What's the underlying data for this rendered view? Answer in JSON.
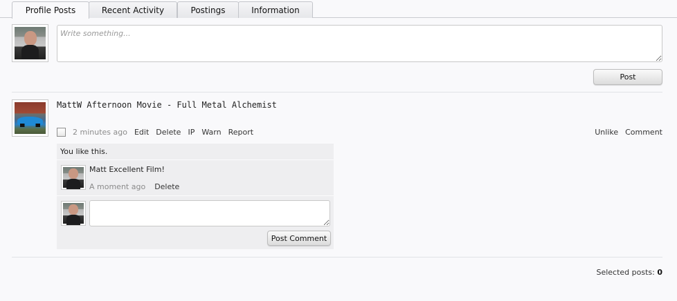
{
  "tabs": [
    {
      "label": "Profile Posts",
      "active": true
    },
    {
      "label": "Recent Activity"
    },
    {
      "label": "Postings"
    },
    {
      "label": "Information"
    }
  ],
  "composer": {
    "placeholder": "Write something...",
    "value": "",
    "post_label": "Post"
  },
  "message": {
    "username": "MattW",
    "text": "Afternoon Movie - Full Metal Alchemist",
    "time": "2 minutes ago",
    "actions": [
      "Edit",
      "Delete",
      "IP",
      "Warn",
      "Report"
    ],
    "right_actions": [
      "Unlike",
      "Comment"
    ],
    "likes_text": "You like this.",
    "comment": {
      "username": "Matt",
      "text": "Excellent Film!",
      "time": "A moment ago",
      "delete_label": "Delete"
    },
    "reply": {
      "value": "",
      "button_label": "Post Comment"
    }
  },
  "footer": {
    "selected_label": "Selected posts:",
    "selected_count": "0"
  },
  "colors": {
    "background": "#f9f9fb",
    "comment_box": "#eeeef0",
    "muted_text": "#8b8b8b"
  }
}
